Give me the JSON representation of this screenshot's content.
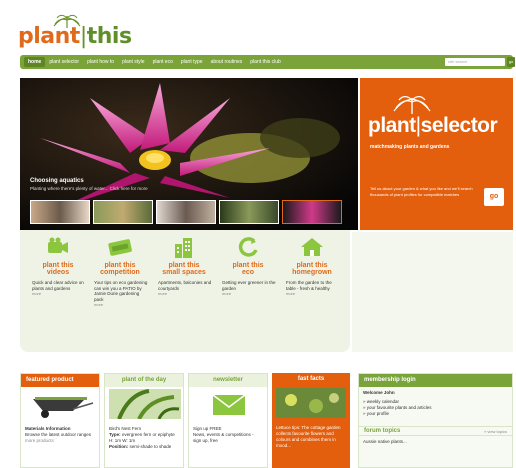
{
  "header": {
    "brand_part1": "plant",
    "brand_sep": "|",
    "brand_part2": "this"
  },
  "nav": {
    "items": [
      "home",
      "plant selector",
      "plant how to",
      "plant style",
      "plant eco",
      "plant type",
      "about routines",
      "plant this club"
    ],
    "search_placeholder": "site search",
    "go_label": "go"
  },
  "hero": {
    "caption_title": "Choosing aquatics",
    "caption_text": "Planting where there's plenty of water... Click here for more"
  },
  "selector": {
    "brand_part1": "plant",
    "brand_part2": "selector",
    "tagline": "matchmaking plants and gardens",
    "description": "Tell us about your garden & what you like and we'll search thousands of plant profiles for compatible matches",
    "go_label": "go"
  },
  "features": [
    {
      "icon": "video-camera-icon",
      "title1": "plant this",
      "title2": "videos",
      "text": "Quick and clear advice on plants and gardens",
      "more": "more"
    },
    {
      "icon": "competition-ticket-icon",
      "title1": "plant this",
      "title2": "competition",
      "text": "Your tips on eco gardening can win you a PATIO by Jamie Durie gardening pack",
      "more": "more"
    },
    {
      "icon": "buildings-icon",
      "title1": "plant this",
      "title2": "small spaces",
      "text": "Apartments, balconies and courtyards",
      "more": "more"
    },
    {
      "icon": "eco-ring-icon",
      "title1": "plant this",
      "title2": "eco",
      "text": "Getting ever greener in the garden",
      "more": "more"
    },
    {
      "icon": "house-icon",
      "title1": "plant this",
      "title2": "homegrown",
      "text": "From the garden to the table - fresh & healthy",
      "more": "more"
    }
  ],
  "featured_product": {
    "title": "featured product",
    "item_title": "Materials Information",
    "text": "Browse the latest outdoor ranges",
    "more": "more products"
  },
  "plant_of_day": {
    "title": "plant of the day",
    "name": "Bird's Nest Fern",
    "type_label": "Type:",
    "type_value": "evergreen fern or epiphyte",
    "size": "H: 1m W: 1m",
    "position_label": "Position:",
    "position_value": "semi-shade to shade"
  },
  "newsletter": {
    "title": "newsletter",
    "signup": "Sign up FREE",
    "text": "News, events & competitions - sign up, free"
  },
  "fast_facts": {
    "title": "fast facts",
    "text": "Lettuce tips: The cottage garden collects favourite flowers and colours and combines them in mood..."
  },
  "membership": {
    "title": "membership login",
    "welcome": "Welcome John",
    "links": [
      "» weekly calendar",
      "» your favourite plants and articles",
      "» your profile"
    ]
  },
  "forum": {
    "title": "forum topics",
    "link": "» view topics",
    "first_item": "Aussie native plants..."
  },
  "colors": {
    "orange": "#e35f0e",
    "green": "#7aa33a",
    "dark_green": "#5d8524"
  }
}
